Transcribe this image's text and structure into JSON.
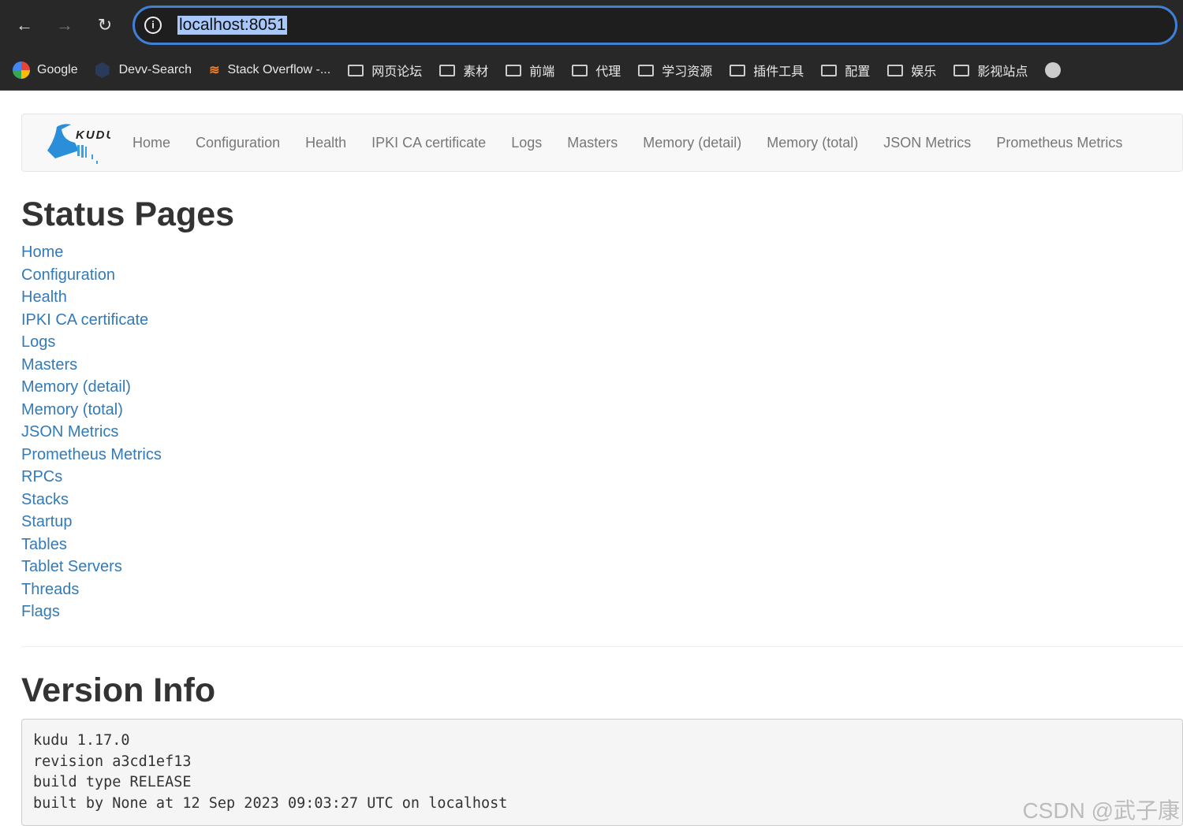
{
  "browser": {
    "url": "localhost:8051",
    "bookmarks": [
      {
        "label": "Google",
        "icon": "google-icon"
      },
      {
        "label": "Devv-Search",
        "icon": "cube-icon"
      },
      {
        "label": "Stack Overflow -...",
        "icon": "stackoverflow-icon"
      },
      {
        "label": "网页论坛",
        "icon": "folder-icon"
      },
      {
        "label": "素材",
        "icon": "folder-icon"
      },
      {
        "label": "前端",
        "icon": "folder-icon"
      },
      {
        "label": "代理",
        "icon": "folder-icon"
      },
      {
        "label": "学习资源",
        "icon": "folder-icon"
      },
      {
        "label": "插件工具",
        "icon": "folder-icon"
      },
      {
        "label": "配置",
        "icon": "folder-icon"
      },
      {
        "label": "娱乐",
        "icon": "folder-icon"
      },
      {
        "label": "影视站点",
        "icon": "folder-icon"
      }
    ]
  },
  "navbar": {
    "logo_text": "KUDU",
    "items": [
      "Home",
      "Configuration",
      "Health",
      "IPKI CA certificate",
      "Logs",
      "Masters",
      "Memory (detail)",
      "Memory (total)",
      "JSON Metrics",
      "Prometheus Metrics"
    ]
  },
  "status": {
    "title": "Status Pages",
    "links": [
      "Home",
      "Configuration",
      "Health",
      "IPKI CA certificate",
      "Logs",
      "Masters",
      "Memory (detail)",
      "Memory (total)",
      "JSON Metrics",
      "Prometheus Metrics",
      "RPCs",
      "Stacks",
      "Startup",
      "Tables",
      "Tablet Servers",
      "Threads",
      "Flags"
    ]
  },
  "version": {
    "title": "Version Info",
    "lines": [
      "kudu 1.17.0",
      "revision a3cd1ef13",
      "build type RELEASE",
      "built by None at 12 Sep 2023 09:03:27 UTC on localhost"
    ]
  },
  "watermark": "CSDN @武子康"
}
